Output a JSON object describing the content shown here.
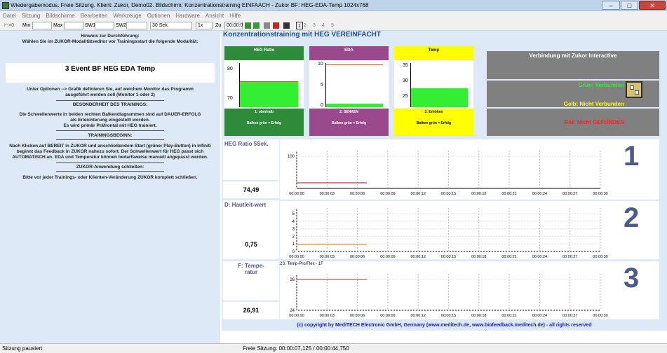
{
  "window": {
    "title": "Wiedergabemodus. Freie Sitzung. Klient: Zukor, Demo02. Bildschirm: Konzentrationstraining EINFAACH - Zukor BF: HEG-EDA-Temp 1024x768"
  },
  "menu": [
    "Datei",
    "Sitzung",
    "Bildschirme",
    "Bearbeiten",
    "Werkzeuge",
    "Optionen",
    "Hardware",
    "Ansicht",
    "Hilfe"
  ],
  "toolbar": {
    "min_label": "Min",
    "max_label": "Max",
    "sw1_label": "SW1",
    "sw2_label": "SW2",
    "timescale": "30 Sek.",
    "speed": "1x",
    "zu_label": "Zu",
    "time": "00:00:0",
    "pages": [
      "1",
      "2",
      "3",
      "4",
      "5"
    ]
  },
  "left": {
    "hint_title": "Hinweis zur Durchführung:",
    "hint_text": "Wählen Sie im ZUKOR-Modalitätseditor vor Trainingsstart die folgende Modalität:",
    "modality": "3 Event BF HEG EDA Temp",
    "p1": "Unter Optionen --> Grafik definieren Sie, auf welchem Monitor das Programm ausgeführt werden soll (Monitor 1 oder 2)",
    "h2": "BESONDERHEIT DES TRAININGS:",
    "p2": "Die Schwellenwerte in beiden rechten Balkendiagrammen sind auf DAUER-ERFOLG als Erleichterung eingestellt worden.",
    "p2b": "Es wird primär Präfrontal mit HEG trainiert.",
    "h3": "TRAININGSBEGINN:",
    "p3": "Nach Klicken auf BEREIT in ZUKOR und anschließendem Start (grüner Play-Button) in Infiniti beginnt das Feedback in ZUKOR nahezu sofort. Der Schwellenwert für HEG passt sich AUTOMATISCH an. EDA und Temperatur können bedarfsweise manuell angepasst werden.",
    "h4": "ZUKOR-Anwendung schließen:",
    "p4": "Bitte vor jeder Trainings- oder Klienten-Veränderung ZUKOR komplett schließen."
  },
  "main": {
    "title": "Konzentrationstraining mit HEG VEREINFACHT"
  },
  "gauges": [
    {
      "title": "HEG Ratio",
      "color": "#2e8b3a",
      "bar_color": "#33ee33",
      "ticks": [
        "80",
        "70"
      ],
      "foot1": "1: oberhalb",
      "foot2": "Balken grün = Erfolg",
      "value_fraction": 0.62
    },
    {
      "title": "EDA",
      "color": "#9a4a8c",
      "bar_color": "#33ee33",
      "ticks": [
        "10",
        "5",
        "0"
      ],
      "foot1": "2: SENKEN",
      "foot2": "Balken grün = Erfolg",
      "value_fraction": 0.08
    },
    {
      "title": "Temp",
      "color": "#ffff00",
      "bar_color": "#33ee33",
      "ticks": [
        "35",
        "30",
        "25"
      ],
      "foot1": "3: Erhöhen",
      "foot2": "Balken grün = Erfolg",
      "value_fraction": 0.45
    }
  ],
  "status": {
    "title": "Verbindung mit Zukor Interactive",
    "green": "Grün: Verbunden",
    "yellow": "Gelb: Nicht Verbunden",
    "red": "Rot: Nicht GEFUNDEN"
  },
  "rows": [
    {
      "label": "HEG Ratio 5Sek.",
      "value": "74,49",
      "number": "1",
      "ylabels": [
        "100"
      ],
      "subtitle": ""
    },
    {
      "label": "D: Hautleit-wert",
      "value": "0,75",
      "number": "2",
      "ylabels": [
        "5",
        "4",
        "3",
        "2",
        "1",
        "0"
      ],
      "subtitle": ""
    },
    {
      "label": "F: Tempe-ratur",
      "value": "26,91",
      "number": "3",
      "ylabels": [
        "26",
        "24"
      ],
      "subtitle": "2S: Temp-Pro/Flex - 1F"
    }
  ],
  "time_ticks": [
    "00:00:00",
    "00:00:03",
    "00:00:06",
    "00:00:09",
    "00:00:12",
    "00:00:15",
    "00:00:18",
    "00:00:21",
    "00:00:24",
    "00:00:27",
    "00:00:30"
  ],
  "footer": "(c) copyright by MediTECH Electronic GmbH, Germany (www.meditech.de, www.biofeedback.meditech.de) - all rights reserved",
  "statusbar": {
    "left": "Sitzung pausiert",
    "center": "Freie Sitzung: 00:00:07,125 / 00:00:44,750"
  }
}
